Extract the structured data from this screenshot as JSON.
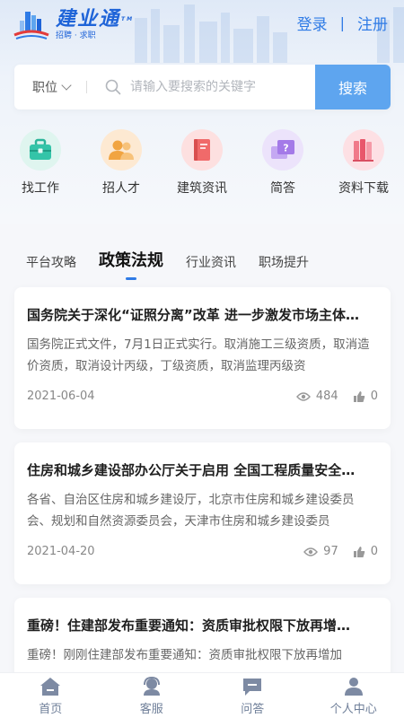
{
  "header": {
    "logo_title": "建业通",
    "logo_tm": "TM",
    "logo_subtitle": "招聘 · 求职",
    "login_label": "登录",
    "auth_separator": "|",
    "register_label": "注册"
  },
  "search": {
    "category_label": "职位",
    "placeholder": "请输入要搜索的关键字",
    "button_label": "搜索"
  },
  "quick_nav": [
    {
      "label": "找工作",
      "icon": "briefcase-icon",
      "color": "#34c4a8",
      "bg": "#dff5ef"
    },
    {
      "label": "招人才",
      "icon": "people-icon",
      "color": "#f1a441",
      "bg": "#fde9d2"
    },
    {
      "label": "建筑资讯",
      "icon": "book-icon",
      "color": "#f06a6a",
      "bg": "#fde0e0"
    },
    {
      "label": "简答",
      "icon": "question-chat-icon",
      "color": "#a47ae8",
      "bg": "#ece3fb"
    },
    {
      "label": "资料下载",
      "icon": "books-icon",
      "color": "#f07a8a",
      "bg": "#fde0e4"
    }
  ],
  "tabs": [
    {
      "label": "平台攻略",
      "active": false
    },
    {
      "label": "政策法规",
      "active": true
    },
    {
      "label": "行业资讯",
      "active": false
    },
    {
      "label": "职场提升",
      "active": false
    }
  ],
  "articles": [
    {
      "title": "国务院关于深化“证照分离”改革 进一步激发市场主体…",
      "summary": "国务院正式文件，7月1日正式实行。取消施工三级资质，取消造价资质，取消设计丙级，丁级资质，取消监理丙级资",
      "date": "2021-06-04",
      "views": "484",
      "likes": "0"
    },
    {
      "title": "住房和城乡建设部办公厅关于启用 全国工程质量安全…",
      "summary": "各省、自治区住房和城乡建设厅，北京市住房和城乡建设委员会、规划和自然资源委员会，天津市住房和城乡建设委员",
      "date": "2021-04-20",
      "views": "97",
      "likes": "0"
    },
    {
      "title": "重磅！住建部发布重要通知：资质审批权限下放再增…",
      "summary": "重磅！刚刚住建部发布重要通知：资质审批权限下放再增加",
      "date": "",
      "views": "",
      "likes": ""
    }
  ],
  "bottom_nav": [
    {
      "label": "首页",
      "icon": "home-icon"
    },
    {
      "label": "客服",
      "icon": "customer-service-icon"
    },
    {
      "label": "问答",
      "icon": "qa-icon"
    },
    {
      "label": "个人中心",
      "icon": "user-icon"
    }
  ],
  "colors": {
    "brand": "#1f64d8",
    "accent": "#2f7be6",
    "search_button": "#5ea5ef",
    "nav_icon": "#7d8aa3"
  }
}
